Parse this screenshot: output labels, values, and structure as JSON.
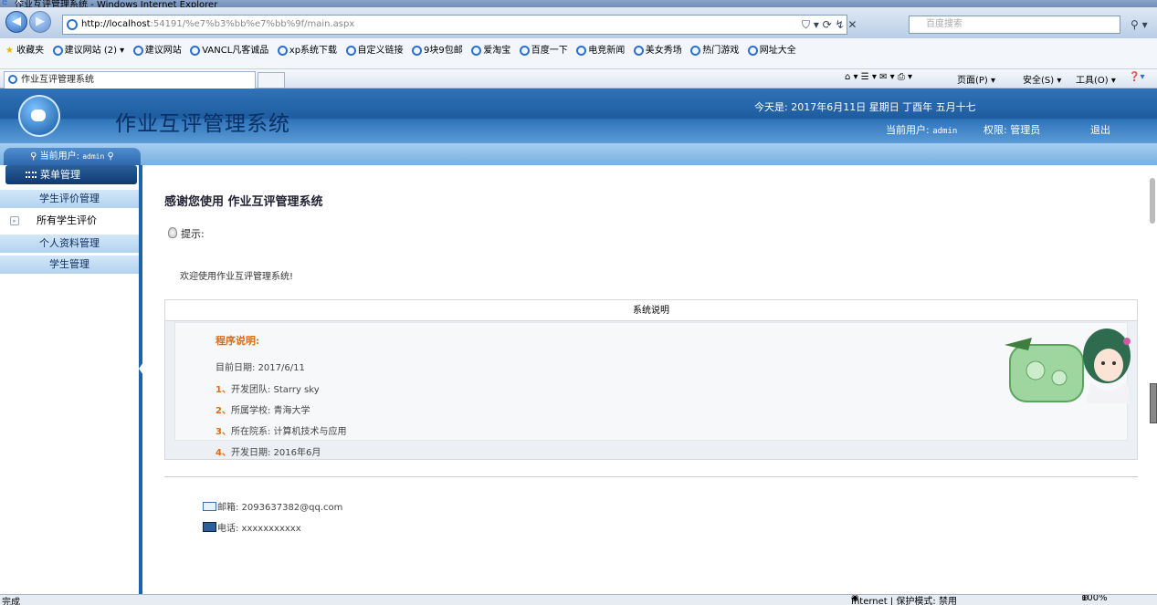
{
  "window": {
    "title": "作业互评管理系统 - Windows Internet Explorer"
  },
  "browser": {
    "address_host": "http://localhost",
    "address_path": ":54191/%e7%b3%bb%e7%bb%9f/main.aspx",
    "search_placeholder": "百度搜索",
    "favorites_label": "收藏夹",
    "favorites": [
      "建议网站 (2) ▾",
      "建议网站",
      "VANCL凡客诚品",
      "xp系统下载",
      "自定义链接",
      "9块9包邮",
      "爱淘宝",
      "百度一下",
      "电竞新闻",
      "美女秀场",
      "热门游戏",
      "网址大全"
    ],
    "tab_label": "作业互评管理系统",
    "cmd_page": "页面(P) ▾",
    "cmd_safety": "安全(S) ▾",
    "cmd_tools": "工具(O) ▾"
  },
  "header": {
    "app_title": "作业互评管理系统",
    "today": "今天是: 2017年6月11日 星期日 丁酉年 五月十七",
    "current_user_label": "当前用户: ",
    "current_user": "admin",
    "role": "权限: 管理员",
    "logout": "退出"
  },
  "sidebar": {
    "current_user_label": "当前用户: ",
    "current_user": "admin",
    "menu_header": "菜单管理",
    "items": [
      {
        "label": "学生评价管理",
        "kind": "category"
      },
      {
        "label": "所有学生评价",
        "kind": "item"
      },
      {
        "label": "个人资料管理",
        "kind": "category"
      },
      {
        "label": "学生管理",
        "kind": "category"
      }
    ]
  },
  "main": {
    "welcome_title": "感谢您使用 作业互评管理系统",
    "tip_label": "提示:",
    "welcome_text": "欢迎使用作业互评管理系统!",
    "table_header": "系统说明",
    "program_title": "程序说明:",
    "date_line": "目前日期: 2017/6/11",
    "lines": [
      {
        "num": "1、",
        "text": "开发团队: Starry sky"
      },
      {
        "num": "2、",
        "text": "所属学校: 青海大学"
      },
      {
        "num": "3、",
        "text": "所在院系: 计算机技术与应用"
      },
      {
        "num": "4、",
        "text": "开发日期: 2016年6月"
      }
    ],
    "email": "邮箱: 2093637382@qq.com",
    "phone": "电话: xxxxxxxxxxx"
  },
  "status": {
    "left": "完成",
    "zone": "Internet | 保护模式: 禁用",
    "zoom": "100%"
  },
  "colors": {
    "header_blue": "#1d5c9e",
    "sidebar_border": "#1c63ad",
    "accent_orange": "#e06a12"
  }
}
